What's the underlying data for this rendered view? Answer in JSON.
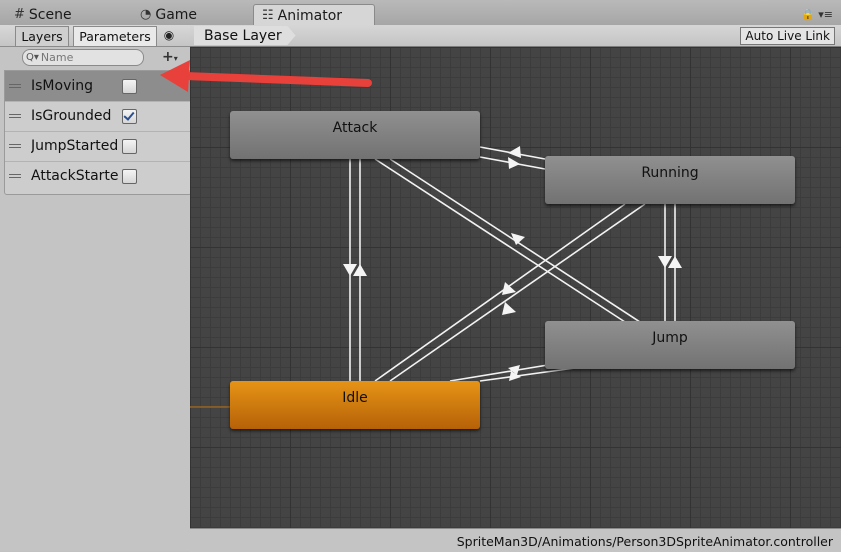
{
  "tabs": [
    {
      "label": "Scene",
      "icon": "scene-grid-icon"
    },
    {
      "label": "Game",
      "icon": "game-pacman-icon"
    },
    {
      "label": "Animator",
      "icon": "animator-icon"
    }
  ],
  "left_panel": {
    "tabs": [
      "Layers",
      "Parameters"
    ],
    "search_placeholder": "Name",
    "parameters": [
      {
        "name": "IsMoving",
        "checked": false,
        "selected": true
      },
      {
        "name": "IsGrounded",
        "checked": true,
        "selected": false
      },
      {
        "name": "JumpStarted",
        "checked": false,
        "selected": false
      },
      {
        "name": "AttackStarted",
        "checked": false,
        "selected": false
      }
    ]
  },
  "graph": {
    "breadcrumb": "Base Layer",
    "auto_live_link": "Auto Live Link",
    "states": {
      "attack": "Attack",
      "running": "Running",
      "jump": "Jump",
      "idle": "Idle"
    }
  },
  "status": {
    "path": "SpriteMan3D/Animations/Person3DSpriteAnimator.controller"
  },
  "colors": {
    "default_state": "#d27a0e",
    "state": "#858585",
    "annotation_arrow": "#e8403a"
  }
}
